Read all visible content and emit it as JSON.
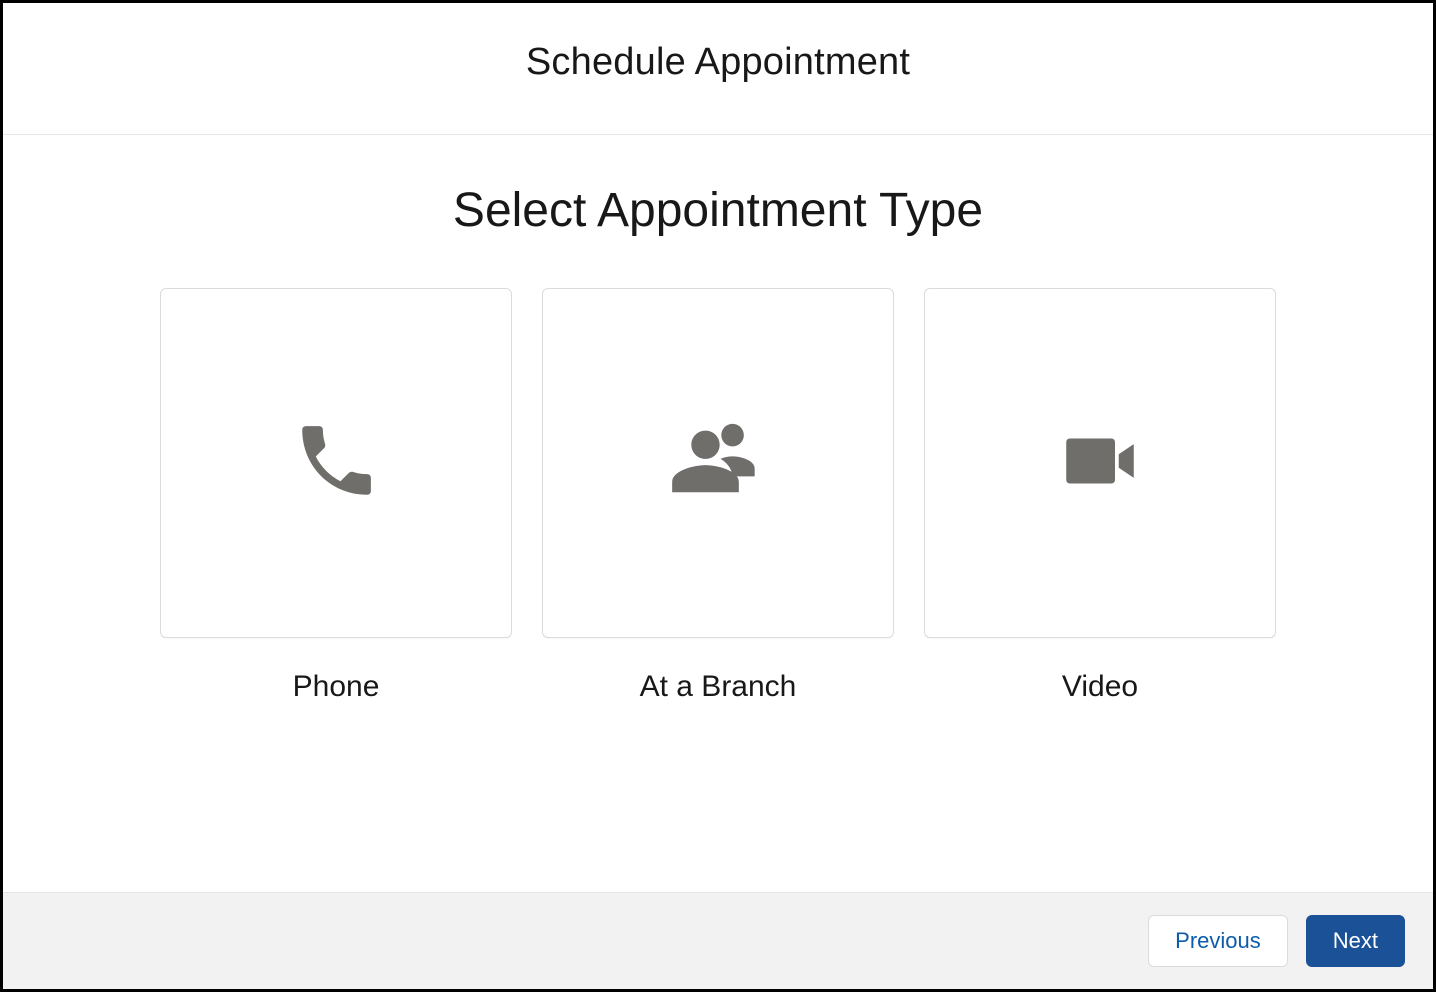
{
  "header": {
    "title": "Schedule Appointment"
  },
  "main": {
    "heading": "Select Appointment Type",
    "options": [
      {
        "label": "Phone",
        "icon": "phone-icon"
      },
      {
        "label": "At a Branch",
        "icon": "people-icon"
      },
      {
        "label": "Video",
        "icon": "video-icon"
      }
    ]
  },
  "footer": {
    "previous_label": "Previous",
    "next_label": "Next"
  },
  "colors": {
    "icon": "#706e6b",
    "primary_button_bg": "#1b5297",
    "link": "#0b5cab"
  }
}
